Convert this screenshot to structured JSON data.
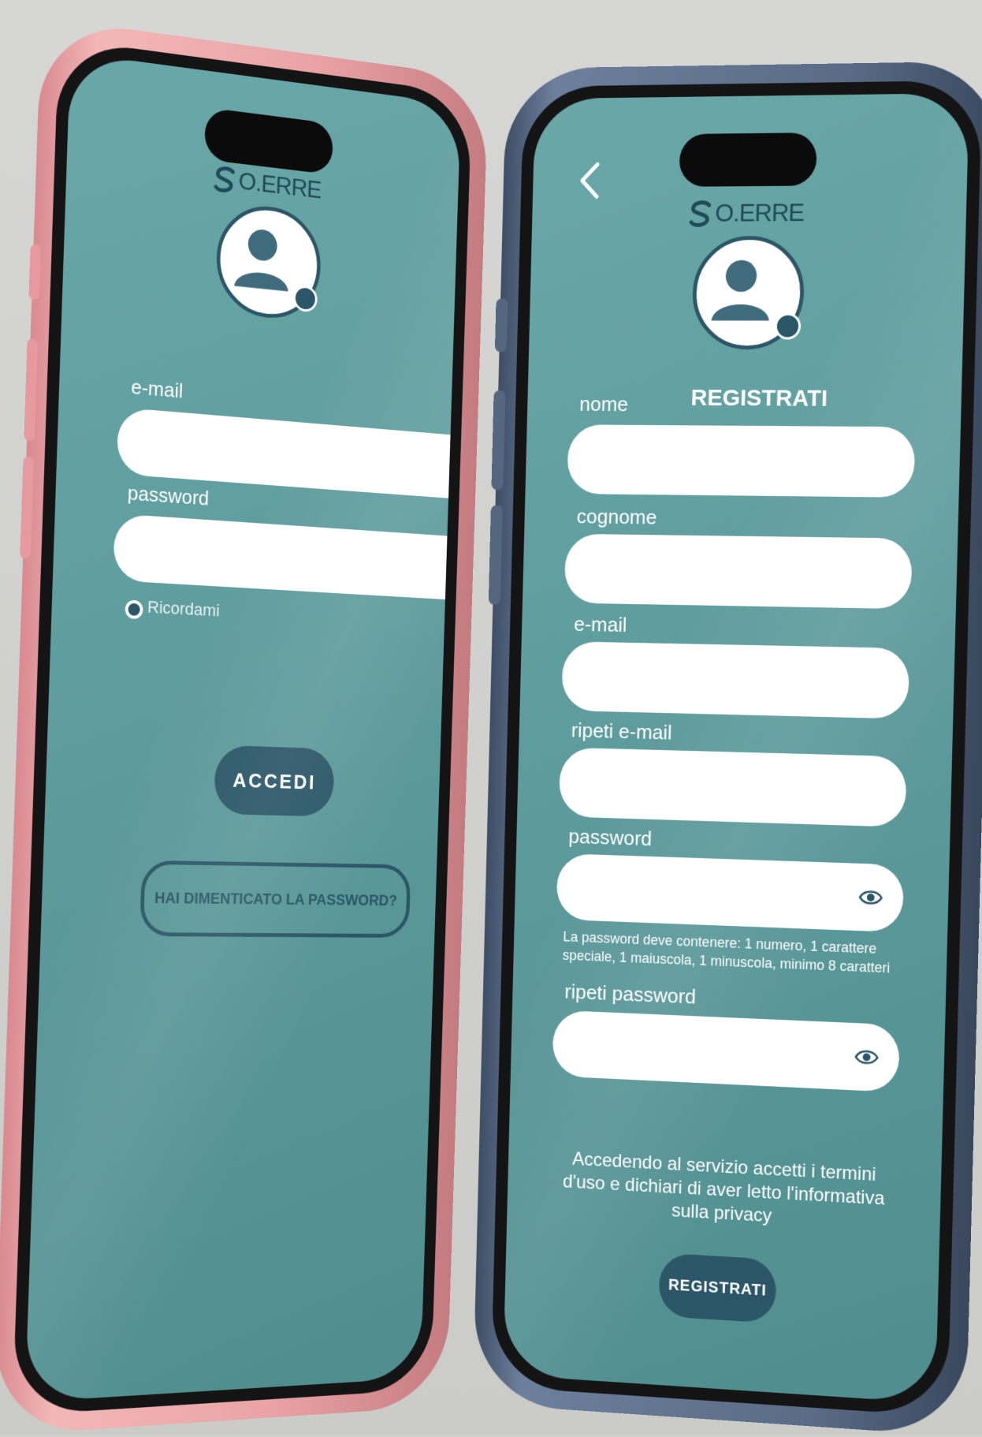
{
  "brand": {
    "logo_text": "O.ERRE"
  },
  "login": {
    "email_label": "e-mail",
    "email_value": "",
    "password_label": "password",
    "password_value": "",
    "remember_label": "Ricordami",
    "login_button": "ACCEDI",
    "forgot_button": "HAI DIMENTICATO LA PASSWORD?"
  },
  "register": {
    "title": "REGISTRATI",
    "fields": [
      {
        "label": "nome",
        "value": ""
      },
      {
        "label": "cognome",
        "value": ""
      },
      {
        "label": "e-mail",
        "value": ""
      },
      {
        "label": "ripeti e-mail",
        "value": ""
      },
      {
        "label": "password",
        "value": ""
      },
      {
        "label": "ripeti password",
        "value": ""
      }
    ],
    "password_hint": "La password deve contenere: 1 numero, 1 carattere speciale, 1 maiuscola, 1 minuscola, minimo 8 caratteri",
    "terms": "Accedendo al servizio accetti i termini d'uso e dichiari di aver letto  l'informativa sulla privacy",
    "submit_button": "REGISTRATI"
  },
  "colors": {
    "screen_bg": "#5f9c9d",
    "accent": "#2b5667",
    "field_bg": "#ffffff",
    "left_frame": "#e9a3a5",
    "right_frame": "#5a6b87"
  },
  "icons": [
    "user-avatar-icon",
    "edit-pencil-icon",
    "eye-icon",
    "back-chevron-icon",
    "logo-mark-icon"
  ]
}
